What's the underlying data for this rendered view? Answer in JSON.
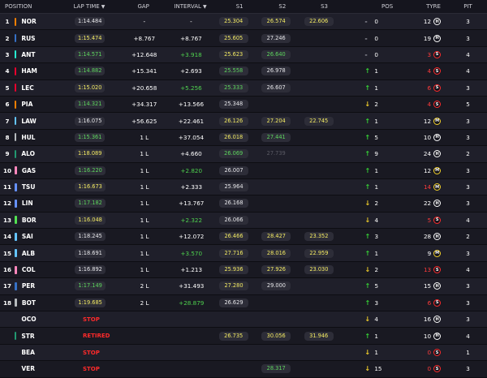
{
  "header": {
    "position": "POSITION",
    "lap_time": "LAP TIME",
    "gap": "GAP",
    "interval": "INTERVAL",
    "s1": "S1",
    "s2": "S2",
    "s3": "S3",
    "pos": "POS",
    "tyre": "TYRE",
    "pit": "PIT"
  },
  "colors": {
    "mclaren": "#ff8000",
    "mercedes": "#27f4d2",
    "ferrari": "#e8002d",
    "redbull": "#3671c6",
    "alpine": "#ff87bc",
    "rb": "#6692ff",
    "williams": "#64c4ff",
    "sauber": "#52e252",
    "aston": "#229971",
    "haas": "#b6babd"
  },
  "rows": [
    {
      "pos": "1",
      "team": "mclaren",
      "driver": "NOR",
      "lap": "1:14.484",
      "lap_c": "white",
      "gap": "-",
      "gap_c": "",
      "int": "-",
      "int_c": "",
      "s1": "25.304",
      "s1_c": "yellow",
      "s2": "26.574",
      "s2_c": "yellow",
      "s3": "22.606",
      "s3_c": "yellow",
      "dir": "none",
      "pch": "0",
      "laps": "12",
      "laps_c": "",
      "tyre": "hard",
      "tyre_l": "H",
      "pit": "3"
    },
    {
      "pos": "2",
      "team": "redbull",
      "driver": "RUS",
      "lap": "1:15.474",
      "lap_c": "yellow",
      "gap": "+8.767",
      "gap_c": "",
      "int": "+8.767",
      "int_c": "",
      "s1": "25.605",
      "s1_c": "yellow",
      "s2": "27.246",
      "s2_c": "white",
      "s3": "",
      "s3_c": "",
      "dir": "none",
      "pch": "0",
      "laps": "19",
      "laps_c": "",
      "tyre": "hard",
      "tyre_l": "H",
      "pit": "3"
    },
    {
      "pos": "3",
      "team": "mercedes",
      "driver": "ANT",
      "lap": "1:14.571",
      "lap_c": "green",
      "gap": "+12.648",
      "gap_c": "",
      "int": "+3.918",
      "int_c": "green",
      "s1": "25.623",
      "s1_c": "yellow",
      "s2": "26.640",
      "s2_c": "green",
      "s3": "",
      "s3_c": "",
      "dir": "none",
      "pch": "0",
      "laps": "3",
      "laps_c": "red",
      "tyre": "soft",
      "tyre_l": "S",
      "pit": "4"
    },
    {
      "pos": "4",
      "team": "ferrari",
      "driver": "HAM",
      "lap": "1:14.882",
      "lap_c": "green",
      "gap": "+15.341",
      "gap_c": "",
      "int": "+2.693",
      "int_c": "",
      "s1": "25.558",
      "s1_c": "green",
      "s2": "26.978",
      "s2_c": "white",
      "s3": "",
      "s3_c": "",
      "dir": "up",
      "pch": "1",
      "laps": "4",
      "laps_c": "red",
      "tyre": "soft",
      "tyre_l": "S",
      "pit": "4"
    },
    {
      "pos": "5",
      "team": "ferrari",
      "driver": "LEC",
      "lap": "1:15.020",
      "lap_c": "yellow",
      "gap": "+20.658",
      "gap_c": "",
      "int": "+5.256",
      "int_c": "green",
      "s1": "25.333",
      "s1_c": "green",
      "s2": "26.607",
      "s2_c": "white",
      "s3": "",
      "s3_c": "",
      "dir": "up",
      "pch": "1",
      "laps": "6",
      "laps_c": "red",
      "tyre": "soft",
      "tyre_l": "S",
      "pit": "3"
    },
    {
      "pos": "6",
      "team": "mclaren",
      "driver": "PIA",
      "lap": "1:14.321",
      "lap_c": "green",
      "gap": "+34.317",
      "gap_c": "",
      "int": "+13.566",
      "int_c": "",
      "s1": "25.348",
      "s1_c": "white",
      "s2": "",
      "s2_c": "",
      "s3": "",
      "s3_c": "",
      "dir": "down",
      "pch": "2",
      "laps": "4",
      "laps_c": "red",
      "tyre": "soft",
      "tyre_l": "S",
      "pit": "5"
    },
    {
      "pos": "7",
      "team": "williams",
      "driver": "LAW",
      "lap": "1:16.075",
      "lap_c": "white",
      "gap": "+56.625",
      "gap_c": "",
      "int": "+22.461",
      "int_c": "",
      "s1": "26.126",
      "s1_c": "yellow",
      "s2": "27.204",
      "s2_c": "yellow",
      "s3": "22.745",
      "s3_c": "yellow",
      "dir": "up",
      "pch": "1",
      "laps": "12",
      "laps_c": "",
      "tyre": "medium",
      "tyre_l": "M",
      "pit": "3"
    },
    {
      "pos": "8",
      "team": "haas",
      "driver": "HUL",
      "lap": "1:15.361",
      "lap_c": "green",
      "gap": "1 L",
      "gap_c": "",
      "int": "+37.054",
      "int_c": "",
      "s1": "26.018",
      "s1_c": "yellow",
      "s2": "27.441",
      "s2_c": "green",
      "s3": "",
      "s3_c": "",
      "dir": "up",
      "pch": "5",
      "laps": "10",
      "laps_c": "",
      "tyre": "hard",
      "tyre_l": "H",
      "pit": "3"
    },
    {
      "pos": "9",
      "team": "aston",
      "driver": "ALO",
      "lap": "1:18.089",
      "lap_c": "yellow",
      "gap": "1 L",
      "gap_c": "",
      "int": "+4.660",
      "int_c": "",
      "s1": "26.069",
      "s1_c": "green",
      "s2": "27.739",
      "s2_c": "grey",
      "s3": "",
      "s3_c": "",
      "dir": "up",
      "pch": "9",
      "laps": "24",
      "laps_c": "",
      "tyre": "hard",
      "tyre_l": "H",
      "pit": "2"
    },
    {
      "pos": "10",
      "team": "alpine",
      "driver": "GAS",
      "lap": "1:16.220",
      "lap_c": "green",
      "gap": "1 L",
      "gap_c": "",
      "int": "+2.820",
      "int_c": "green",
      "s1": "26.007",
      "s1_c": "white",
      "s2": "",
      "s2_c": "",
      "s3": "",
      "s3_c": "",
      "dir": "up",
      "pch": "1",
      "laps": "12",
      "laps_c": "",
      "tyre": "medium",
      "tyre_l": "M",
      "pit": "3"
    },
    {
      "pos": "11",
      "team": "rb",
      "driver": "TSU",
      "lap": "1:16.673",
      "lap_c": "yellow",
      "gap": "1 L",
      "gap_c": "",
      "int": "+2.333",
      "int_c": "",
      "s1": "25.964",
      "s1_c": "white",
      "s2": "",
      "s2_c": "",
      "s3": "",
      "s3_c": "",
      "dir": "up",
      "pch": "1",
      "laps": "14",
      "laps_c": "red",
      "tyre": "medium",
      "tyre_l": "M",
      "pit": "3"
    },
    {
      "pos": "12",
      "team": "rb",
      "driver": "LIN",
      "lap": "1:17.182",
      "lap_c": "green",
      "gap": "1 L",
      "gap_c": "",
      "int": "+13.767",
      "int_c": "",
      "s1": "26.168",
      "s1_c": "white",
      "s2": "",
      "s2_c": "",
      "s3": "",
      "s3_c": "",
      "dir": "down",
      "pch": "2",
      "laps": "22",
      "laps_c": "",
      "tyre": "hard",
      "tyre_l": "H",
      "pit": "3"
    },
    {
      "pos": "13",
      "team": "sauber",
      "driver": "BOR",
      "lap": "1:16.048",
      "lap_c": "yellow",
      "gap": "1 L",
      "gap_c": "",
      "int": "+2.322",
      "int_c": "green",
      "s1": "26.066",
      "s1_c": "white",
      "s2": "",
      "s2_c": "",
      "s3": "",
      "s3_c": "",
      "dir": "down",
      "pch": "4",
      "laps": "5",
      "laps_c": "red",
      "tyre": "soft",
      "tyre_l": "S",
      "pit": "4"
    },
    {
      "pos": "14",
      "team": "williams",
      "driver": "SAI",
      "lap": "1:18.245",
      "lap_c": "white",
      "gap": "1 L",
      "gap_c": "",
      "int": "+12.072",
      "int_c": "",
      "s1": "26.466",
      "s1_c": "yellow",
      "s2": "28.427",
      "s2_c": "yellow",
      "s3": "23.352",
      "s3_c": "yellow",
      "dir": "up",
      "pch": "3",
      "laps": "28",
      "laps_c": "",
      "tyre": "hard",
      "tyre_l": "H",
      "pit": "2"
    },
    {
      "pos": "15",
      "team": "williams",
      "driver": "ALB",
      "lap": "1:18.691",
      "lap_c": "white",
      "gap": "1 L",
      "gap_c": "",
      "int": "+3.570",
      "int_c": "green",
      "s1": "27.716",
      "s1_c": "yellow",
      "s2": "28.016",
      "s2_c": "yellow",
      "s3": "22.959",
      "s3_c": "yellow",
      "dir": "up",
      "pch": "1",
      "laps": "9",
      "laps_c": "",
      "tyre": "medium",
      "tyre_l": "M",
      "pit": "3"
    },
    {
      "pos": "16",
      "team": "alpine",
      "driver": "COL",
      "lap": "1:16.892",
      "lap_c": "white",
      "gap": "1 L",
      "gap_c": "",
      "int": "+1.213",
      "int_c": "",
      "s1": "25.936",
      "s1_c": "yellow",
      "s2": "27.926",
      "s2_c": "yellow",
      "s3": "23.030",
      "s3_c": "yellow",
      "dir": "down",
      "pch": "2",
      "laps": "13",
      "laps_c": "red",
      "tyre": "soft",
      "tyre_l": "S",
      "pit": "4"
    },
    {
      "pos": "17",
      "team": "redbull",
      "driver": "PER",
      "lap": "1:17.149",
      "lap_c": "green",
      "gap": "2 L",
      "gap_c": "",
      "int": "+31.493",
      "int_c": "",
      "s1": "27.280",
      "s1_c": "yellow",
      "s2": "29.000",
      "s2_c": "white",
      "s3": "",
      "s3_c": "",
      "dir": "up",
      "pch": "5",
      "laps": "15",
      "laps_c": "",
      "tyre": "hard",
      "tyre_l": "H",
      "pit": "3"
    },
    {
      "pos": "18",
      "team": "haas",
      "driver": "BOT",
      "lap": "1:19.685",
      "lap_c": "yellow",
      "gap": "2 L",
      "gap_c": "",
      "int": "+28.879",
      "int_c": "green",
      "s1": "26.629",
      "s1_c": "white",
      "s2": "",
      "s2_c": "",
      "s3": "",
      "s3_c": "",
      "dir": "up",
      "pch": "3",
      "laps": "6",
      "laps_c": "red",
      "tyre": "soft",
      "tyre_l": "S",
      "pit": "3"
    },
    {
      "pos": "",
      "team": "",
      "driver": "OCO",
      "lap": "STOP",
      "lap_c": "red",
      "gap": "",
      "gap_c": "",
      "int": "",
      "int_c": "",
      "s1": "",
      "s1_c": "",
      "s2": "",
      "s2_c": "",
      "s3": "",
      "s3_c": "",
      "dir": "down",
      "pch": "4",
      "laps": "16",
      "laps_c": "",
      "tyre": "hard",
      "tyre_l": "H",
      "pit": "3"
    },
    {
      "pos": "",
      "team": "aston",
      "driver": "STR",
      "lap": "RETIRED",
      "lap_c": "red",
      "gap": "",
      "gap_c": "",
      "int": "",
      "int_c": "",
      "s1": "26.735",
      "s1_c": "yellow",
      "s2": "30.056",
      "s2_c": "yellow",
      "s3": "31.946",
      "s3_c": "yellow",
      "dir": "up",
      "pch": "1",
      "laps": "10",
      "laps_c": "",
      "tyre": "hard",
      "tyre_l": "H",
      "pit": "4"
    },
    {
      "pos": "",
      "team": "",
      "driver": "BEA",
      "lap": "STOP",
      "lap_c": "red",
      "gap": "",
      "gap_c": "",
      "int": "",
      "int_c": "",
      "s1": "",
      "s1_c": "",
      "s2": "",
      "s2_c": "",
      "s3": "",
      "s3_c": "",
      "dir": "down",
      "pch": "1",
      "laps": "0",
      "laps_c": "red",
      "tyre": "soft",
      "tyre_l": "S",
      "pit": "1"
    },
    {
      "pos": "",
      "team": "",
      "driver": "VER",
      "lap": "STOP",
      "lap_c": "red",
      "gap": "",
      "gap_c": "",
      "int": "",
      "int_c": "",
      "s1": "",
      "s1_c": "",
      "s2": "28.317",
      "s2_c": "green",
      "s3": "",
      "s3_c": "",
      "dir": "down",
      "pch": "15",
      "laps": "0",
      "laps_c": "red",
      "tyre": "soft",
      "tyre_l": "S",
      "pit": "3"
    }
  ]
}
